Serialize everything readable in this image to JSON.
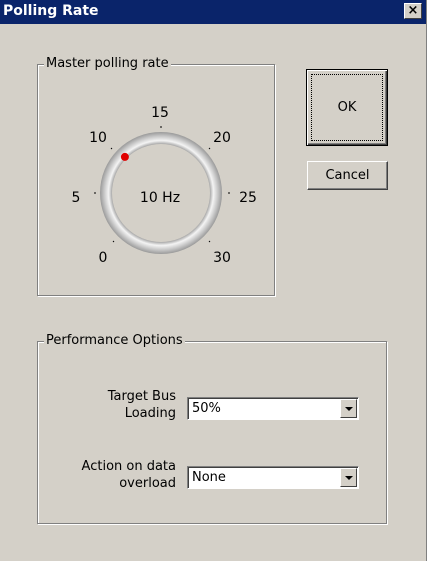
{
  "window": {
    "title": "Polling Rate",
    "close_label": "×"
  },
  "master_group": {
    "label": "Master polling rate",
    "knob": {
      "value_text": "10 Hz",
      "value": 10,
      "min": 0,
      "max": 30,
      "indicator_color": "#e00000",
      "tick_labels": [
        "0",
        "5",
        "10",
        "15",
        "20",
        "25",
        "30"
      ]
    }
  },
  "buttons": {
    "ok_label": "OK",
    "cancel_label": "Cancel"
  },
  "performance_group": {
    "label": "Performance Options",
    "target_bus": {
      "label_line1": "Target Bus",
      "label_line2": "Loading",
      "value": "50%"
    },
    "overload": {
      "label_line1": "Action on data",
      "label_line2": "overload",
      "value": "None"
    }
  }
}
